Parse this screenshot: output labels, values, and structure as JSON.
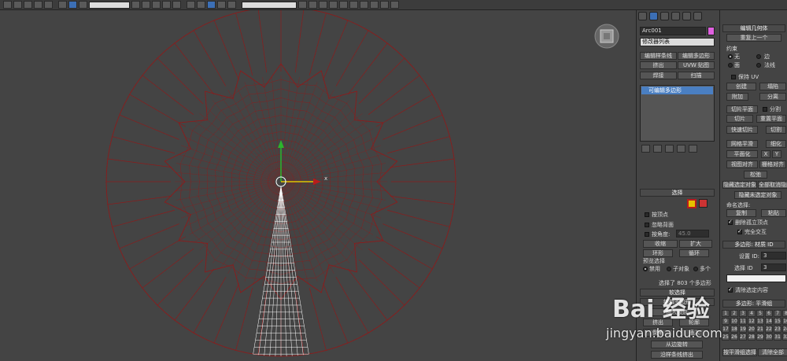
{
  "toolbar": {
    "dropdown_value": "",
    "icons": [
      "undo-icon",
      "redo-icon",
      "link-icon",
      "unlink-icon",
      "bind-icon",
      "selection-filter-icon",
      "select-icon",
      "select-by-name-icon",
      "rect-select-icon",
      "window-crossing-icon",
      "move-icon",
      "rotate-icon",
      "scale-icon",
      "reference-coord-icon",
      "pivot-icon",
      "snap-icon",
      "angle-snap-icon",
      "percent-snap-icon",
      "mirror-icon",
      "align-icon",
      "layer-icon",
      "curve-editor-icon",
      "schematic-icon",
      "material-editor-icon",
      "render-setup-icon",
      "render-frame-icon",
      "render-icon",
      "teapot-render-icon"
    ]
  },
  "viewport": {
    "nav_cube_label": "",
    "axis_x_label": "x",
    "colors": {
      "wire_selected": "#8b1c1c",
      "wire_highlight": "#ffffff",
      "background": "#444444"
    }
  },
  "command_panel": {
    "object_name": "Arc001",
    "object_color": "#e060e0",
    "modifier_list_label": "修改器列表",
    "buttons": {
      "edit_spline": "编辑样条线",
      "edit_poly": "编辑多边形",
      "extrude": "挤出",
      "uvw_map": "UVW 贴图",
      "lathe": "焊接",
      "sweep": "扫描"
    },
    "stack_item": "可编辑多边形",
    "selection": {
      "rollout_title": "选择",
      "by_vertex": "按顶点",
      "ignore_backfacing": "忽略背面",
      "by_angle": "按角度:",
      "angle_value": "45.0",
      "shrink": "收缩",
      "grow": "扩大",
      "ring": "环形",
      "loop": "循环",
      "preview_title": "预览选择",
      "preview_disabled": "禁用",
      "preview_subobject": "子对象",
      "preview_multi": "多个",
      "status": "选择了 803 个多边形"
    },
    "soft_selection_title": "软选择",
    "edit_polygons_title": "编辑多边形",
    "insert_vertex": "插入顶点",
    "outline": "轮廓",
    "extrude_label": "挤出",
    "bevel": "倒角",
    "inset": "插入",
    "from_edge": "从边旋转",
    "extrude_along_spline": "沿样条线挤出"
  },
  "ribbon": {
    "edit_geometry_title": "编辑几何体",
    "repeat_last": "重复上一个",
    "constraints": "约束",
    "none": "无",
    "edge": "边",
    "face": "面",
    "normal": "法线",
    "preserve_uv": "保持 UV",
    "create": "创建",
    "collapse": "塌陷",
    "attach": "附加",
    "detach": "分离",
    "slice_plane": "切片平面",
    "split": "分割",
    "slice": "切片",
    "reset_plane": "重置平面",
    "quickslice": "快速切片",
    "cut": "切割",
    "msmooth": "网格平滑",
    "tessellate": "细化",
    "planarize": "平面化",
    "x": "X",
    "y": "Y",
    "view_align": "视图对齐",
    "grid_align": "栅格对齐",
    "relax": "松弛",
    "hide_selected": "隐藏选定对象",
    "unhide_all": "全部取消隐藏",
    "hide_unselected": "隐藏未选定对象",
    "named_selections": "命名选择:",
    "copy": "复制",
    "paste": "粘贴",
    "delete_isolated": "删除孤立顶点",
    "full_interactivity": "完全交互",
    "poly_material_ids_title": "多边形: 材质 ID",
    "set_id": "设置 ID:",
    "set_id_value": "3",
    "select_id": "选择 ID",
    "select_id_value": "3",
    "clear_selection": "清除选定内容",
    "smoothing_groups_title": "多边形: 平滑组",
    "smoothing_numbers": [
      "1",
      "2",
      "3",
      "4",
      "5",
      "6",
      "7",
      "8",
      "9",
      "10",
      "11",
      "12",
      "13",
      "14",
      "15",
      "16",
      "17",
      "18",
      "19",
      "20",
      "21",
      "22",
      "23",
      "24",
      "25",
      "26",
      "27",
      "28",
      "29",
      "30",
      "31",
      "32"
    ],
    "select_by_sg": "按平滑组选择",
    "clear_all": "清除全部"
  },
  "watermark": {
    "cn": "Bai 经验",
    "url": "jingyan.baidu.com"
  }
}
